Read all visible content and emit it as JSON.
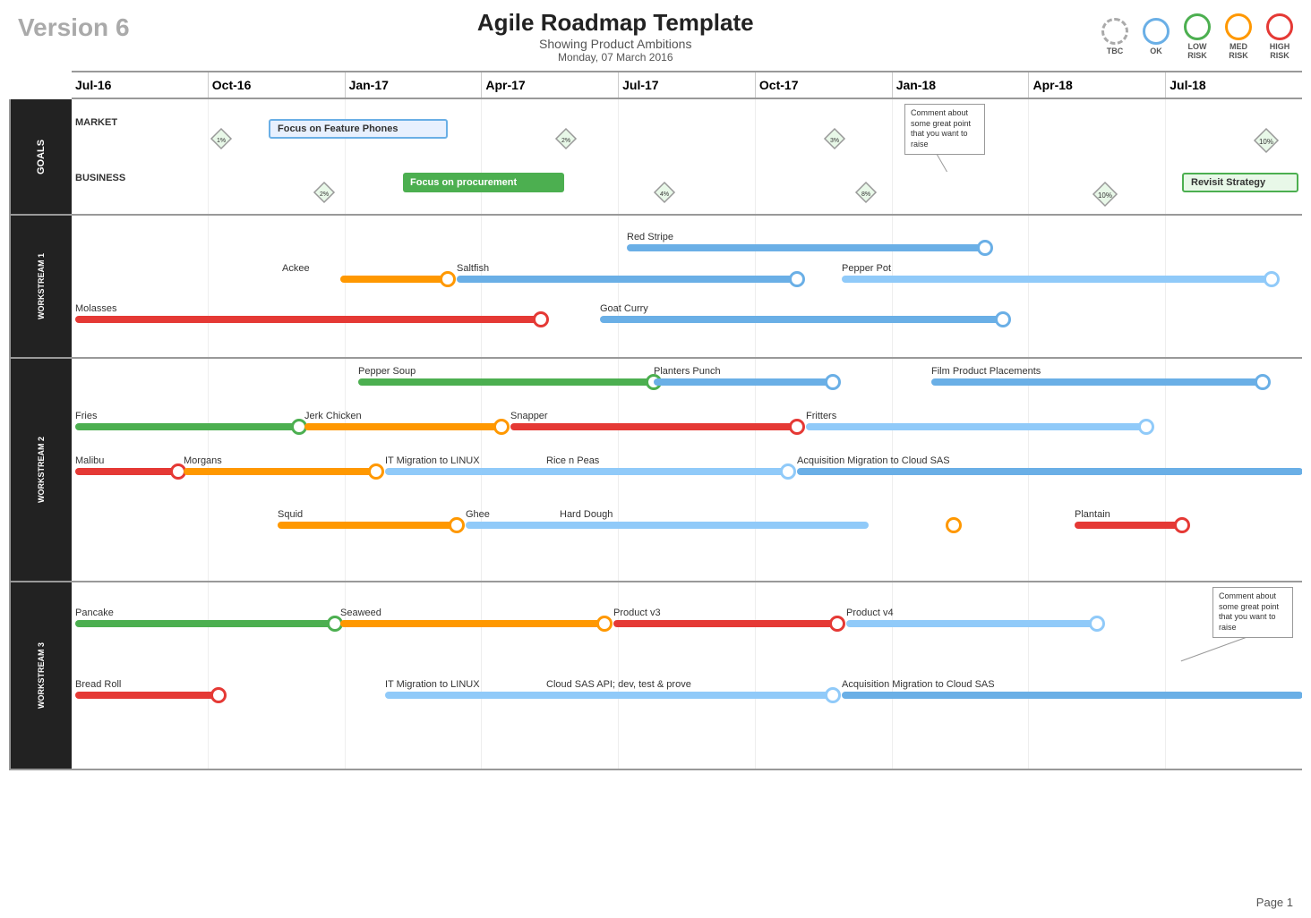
{
  "header": {
    "version": "Version 6",
    "title": "Agile Roadmap Template",
    "subtitle": "Showing Product Ambitions",
    "date": "Monday, 07 March 2016"
  },
  "legend": {
    "items": [
      {
        "label": "TBC",
        "type": "tbc"
      },
      {
        "label": "OK",
        "type": "ok"
      },
      {
        "label": "LOW\nRISK",
        "type": "low"
      },
      {
        "label": "MED\nRISK",
        "type": "med"
      },
      {
        "label": "HIGH\nRISK",
        "type": "high"
      }
    ]
  },
  "timeline": {
    "months": [
      "Jul-16",
      "Oct-16",
      "Jan-17",
      "Apr-17",
      "Jul-17",
      "Oct-17",
      "Jan-18",
      "Apr-18",
      "Jul-18"
    ]
  },
  "sections": {
    "goals_label": "GOALS",
    "ws1_label": "WORKSTREAM 1",
    "ws2_label": "WORKSTREAM 2",
    "ws3_label": "WORKSTREAM 3"
  },
  "comments": {
    "comment1": "Comment about some great point that you want to raise",
    "comment2": "Comment about some great point that you want to raise"
  },
  "page_number": "Page 1"
}
